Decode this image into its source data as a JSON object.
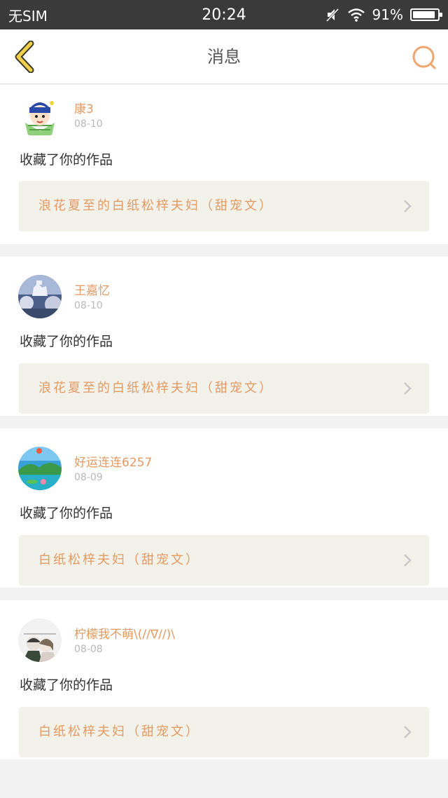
{
  "status_bar": {
    "carrier": "无SIM",
    "time": "20:24",
    "battery": "91%",
    "battery_level": 0.91
  },
  "header": {
    "title": "消息"
  },
  "messages": [
    {
      "username": "康3",
      "date": "08-10",
      "action": "收藏了你的作品",
      "work_title": "浪花夏至的白纸松梓夫妇（甜宠文）",
      "avatar": "cartoon-avatar"
    },
    {
      "username": "王嘉忆",
      "date": "08-10",
      "action": "收藏了你的作品",
      "work_title": "浪花夏至的白纸松梓夫妇（甜宠文）",
      "avatar": "castle-photo-avatar"
    },
    {
      "username": "好运连连6257",
      "date": "08-09",
      "action": "收藏了你的作品",
      "work_title": "白纸松梓夫妇（甜宠文）",
      "avatar": "landscape-photo-avatar"
    },
    {
      "username": "柠檬我不萌\\(//∇//)\\",
      "date": "08-08",
      "action": "收藏了你的作品",
      "work_title": "白纸松梓夫妇（甜宠文）",
      "avatar": "anime-couple-avatar"
    }
  ],
  "colors": {
    "accent": "#e39a63",
    "work_bg": "#f2f2ea",
    "status_bg": "#3a3a3a"
  }
}
